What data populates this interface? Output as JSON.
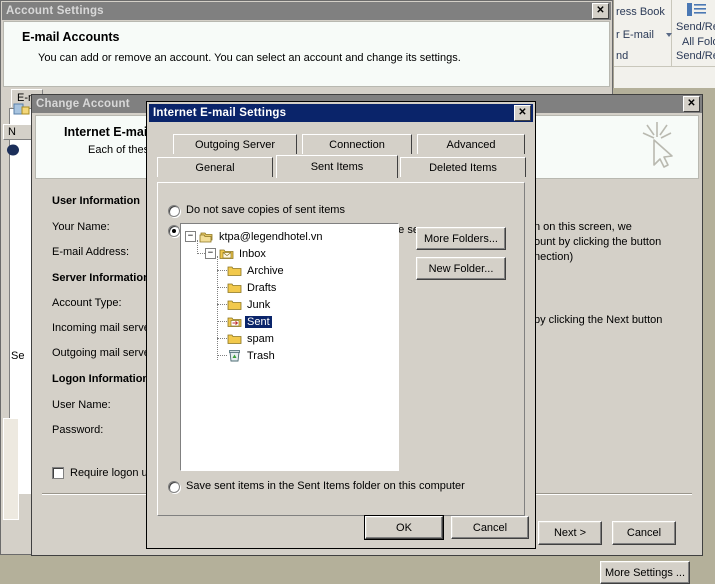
{
  "ribbon": {
    "address_book": "ress Book",
    "new_email": "r E-mail",
    "find_label": "nd",
    "send_receive_1": "Send/Re",
    "send_receive_2": "All Folo",
    "send_receive_3": "Send/Re"
  },
  "account_settings": {
    "title": "Account Settings",
    "close": "✕",
    "heading": "E-mail Accounts",
    "description": "You can add or remove an account. You can select an account and change its settings.",
    "tab_label": "E-m",
    "column_header": "N",
    "footer_text": "Se"
  },
  "change_account": {
    "title": "Change Account",
    "close": "✕",
    "heading": "Internet E-mail",
    "subheading": "Each of these",
    "sections": {
      "user_information": "User Information",
      "server_information": "Server Information",
      "logon_information": "Logon Information"
    },
    "fields": [
      {
        "label": "Your Name:"
      },
      {
        "label": "E-mail Address:"
      },
      {
        "label": "Account Type:"
      },
      {
        "label": "Incoming mail serve"
      },
      {
        "label": "Outgoing mail serve"
      },
      {
        "label": "User Name:"
      },
      {
        "label": "Password:"
      }
    ],
    "require_logon_label": "Require logon u",
    "right_text": [
      "n on this screen, we",
      "ount by clicking the button",
      "nection)",
      "by clicking the Next button"
    ],
    "more_settings_label": "More Settings ...",
    "next_label": "Next >",
    "cancel_label": "Cancel"
  },
  "ies_dialog": {
    "title": "Internet E-mail Settings",
    "close": "✕",
    "tabs_row1": [
      {
        "label": "Outgoing Server",
        "active": false
      },
      {
        "label": "Connection",
        "active": false
      },
      {
        "label": "Advanced",
        "active": false
      }
    ],
    "tabs_row2": [
      {
        "label": "General",
        "active": false
      },
      {
        "label": "Sent Items",
        "active": true
      },
      {
        "label": "Deleted Items",
        "active": false
      }
    ],
    "radio_options": [
      {
        "label": "Do not save copies of sent items",
        "selected": false
      },
      {
        "label": "Save sent items in the following folder on the server:",
        "selected": true
      },
      {
        "label": "Save sent items in the Sent Items folder on this computer",
        "selected": false
      }
    ],
    "tree": {
      "root": {
        "label": "ktpa@legendhotel.vn",
        "icon": "folders-stack-icon",
        "expanded": true
      },
      "inbox": {
        "label": "Inbox",
        "icon": "inbox-folder-icon",
        "expanded": true
      },
      "children": [
        {
          "label": "Archive",
          "icon": "folder-icon",
          "selected": false
        },
        {
          "label": "Drafts",
          "icon": "folder-icon",
          "selected": false
        },
        {
          "label": "Junk",
          "icon": "folder-icon",
          "selected": false
        },
        {
          "label": "Sent",
          "icon": "sent-folder-icon",
          "selected": true
        },
        {
          "label": "spam",
          "icon": "folder-icon",
          "selected": false
        },
        {
          "label": "Trash",
          "icon": "trash-icon",
          "selected": false
        }
      ]
    },
    "buttons": {
      "more_folders": "More Folders...",
      "new_folder": "New Folder...",
      "ok": "OK",
      "cancel": "Cancel"
    }
  },
  "colors": {
    "active_title": "#0a246a",
    "inactive_title": "#808080",
    "face": "#d4d0c8",
    "selection": "#0a246a",
    "desktop": "#b4b09a"
  }
}
